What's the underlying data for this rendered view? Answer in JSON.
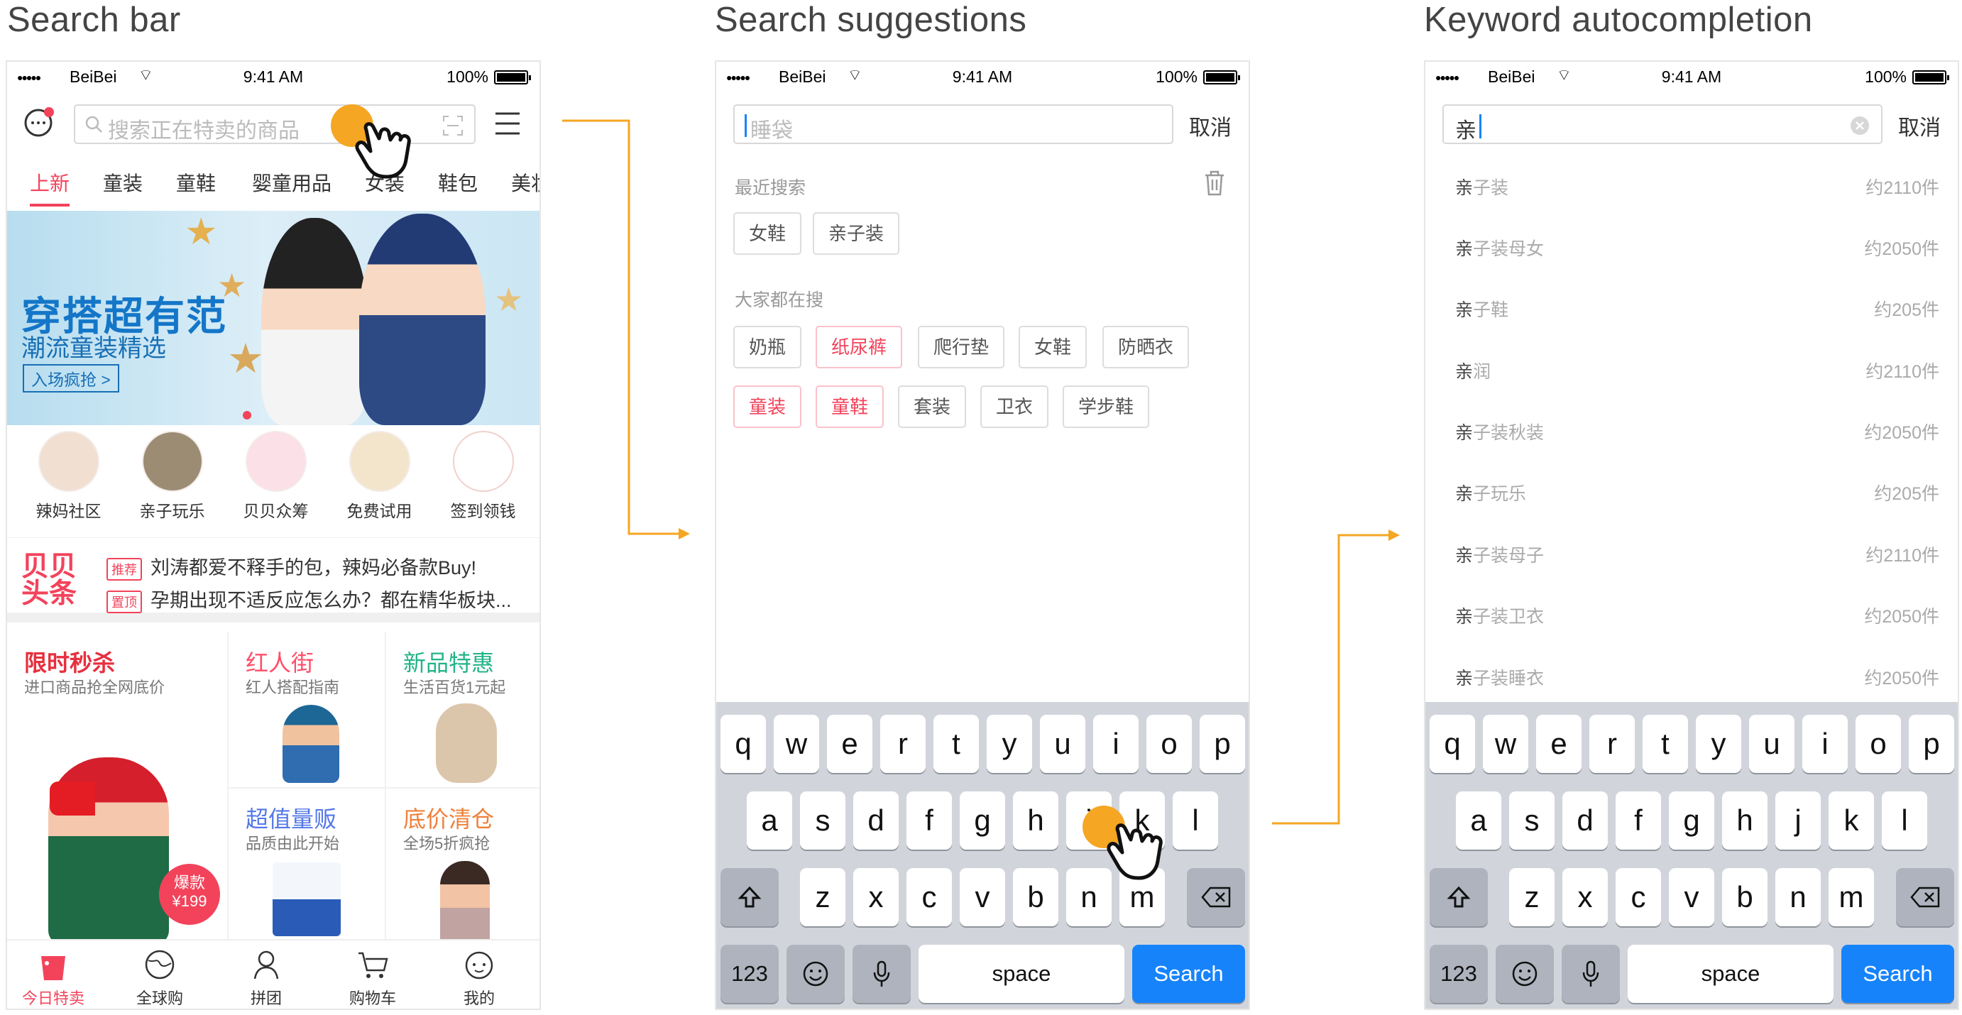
{
  "titles": {
    "search_bar": "Search bar",
    "suggestions": "Search suggestions",
    "autocomplete": "Keyword autocompletion"
  },
  "status": {
    "carrier": "BeiBei",
    "time": "9:41 AM",
    "battery": "100%"
  },
  "screen1": {
    "search_placeholder": "搜索正在特卖的商品",
    "tabs": [
      "上新",
      "童装",
      "童鞋",
      "婴童用品",
      "女装",
      "鞋包",
      "美妆"
    ],
    "banner": {
      "title": "穿搭超有范",
      "subtitle": "潮流童装精选",
      "cta": "入场疯抢 >"
    },
    "categories": [
      "辣妈社区",
      "亲子玩乐",
      "贝贝众筹",
      "免费试用",
      "签到领钱"
    ],
    "news_logo": "贝贝头条",
    "news": [
      {
        "tag": "推荐",
        "text": "刘涛都爱不释手的包，辣妈必备款Buy!"
      },
      {
        "tag": "置顶",
        "text": "孕期出现不适反应怎么办？都在精华板块..."
      }
    ],
    "promos": [
      {
        "title": "限时秒杀",
        "subtitle": "进口商品抢全网底价",
        "color": "#e72f3e",
        "badge_top": "爆款",
        "badge_price": "¥199"
      },
      {
        "title": "红人街",
        "subtitle": "红人搭配指南",
        "color": "#ff4d68"
      },
      {
        "title": "新品特惠",
        "subtitle": "生活百货1元起",
        "color": "#22b488"
      },
      {
        "title": "超值量贩",
        "subtitle": "品质由此开始",
        "color": "#5578e8"
      },
      {
        "title": "底价清仓",
        "subtitle": "全场5折疯抢",
        "color": "#f0803a"
      }
    ],
    "bottom_nav": [
      "今日特卖",
      "全球购",
      "拼团",
      "购物车",
      "我的"
    ]
  },
  "screen2": {
    "search_placeholder": "睡袋",
    "cancel": "取消",
    "recent_label": "最近搜索",
    "recent": [
      "女鞋",
      "亲子装"
    ],
    "popular_label": "大家都在搜",
    "popular_row1": [
      {
        "text": "奶瓶",
        "hot": false
      },
      {
        "text": "纸尿裤",
        "hot": true
      },
      {
        "text": "爬行垫",
        "hot": false
      },
      {
        "text": "女鞋",
        "hot": false
      },
      {
        "text": "防晒衣",
        "hot": false
      }
    ],
    "popular_row2": [
      {
        "text": "童装",
        "hot": true
      },
      {
        "text": "童鞋",
        "hot": true
      },
      {
        "text": "套装",
        "hot": false
      },
      {
        "text": "卫衣",
        "hot": false
      },
      {
        "text": "学步鞋",
        "hot": false
      }
    ]
  },
  "screen3": {
    "input": "亲",
    "cancel": "取消",
    "suggestions": [
      {
        "prefix": "亲",
        "rest": "子装",
        "count": "约2110件"
      },
      {
        "prefix": "亲",
        "rest": "子装母女",
        "count": "约2050件"
      },
      {
        "prefix": "亲",
        "rest": "子鞋",
        "count": "约205件"
      },
      {
        "prefix": "亲",
        "rest": "润",
        "count": "约2110件"
      },
      {
        "prefix": "亲",
        "rest": "子装秋装",
        "count": "约2050件"
      },
      {
        "prefix": "亲",
        "rest": "子玩乐",
        "count": "约205件"
      },
      {
        "prefix": "亲",
        "rest": "子装母子",
        "count": "约2110件"
      },
      {
        "prefix": "亲",
        "rest": "子装卫衣",
        "count": "约2050件"
      },
      {
        "prefix": "亲",
        "rest": "子装睡衣",
        "count": "约2050件"
      }
    ]
  },
  "keyboard": {
    "row1": [
      "q",
      "w",
      "e",
      "r",
      "t",
      "y",
      "u",
      "i",
      "o",
      "p"
    ],
    "row2": [
      "a",
      "s",
      "d",
      "f",
      "g",
      "h",
      "j",
      "k",
      "l"
    ],
    "row3": [
      "z",
      "x",
      "c",
      "v",
      "b",
      "n",
      "m"
    ],
    "num": "123",
    "space": "space",
    "search": "Search"
  },
  "colors": {
    "accent": "#f2435b",
    "arrow": "#f5a623",
    "keyboard_blue": "#1683fb"
  },
  "icons": {
    "message": "message-icon",
    "search": "search-icon",
    "scan": "scan-icon",
    "menu": "menu-icon",
    "trash": "trash-icon",
    "clear": "clear-icon",
    "shift": "shift-icon",
    "backspace": "backspace-icon",
    "emoji": "emoji-icon",
    "mic": "mic-icon",
    "tap": "hand-tap-icon"
  }
}
